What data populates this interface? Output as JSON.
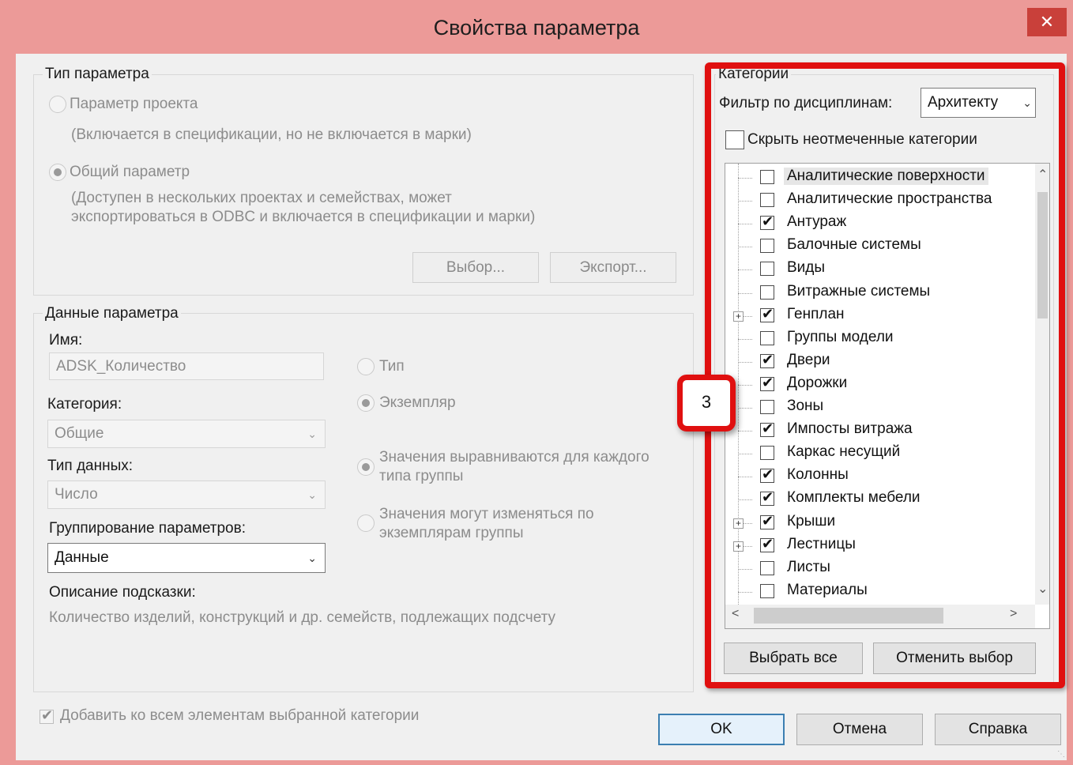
{
  "window": {
    "title": "Свойства параметра",
    "close_symbol": "✕"
  },
  "param_type": {
    "group_title": "Тип параметра",
    "project_param_label": "Параметр проекта",
    "project_param_note": "(Включается в спецификации, но не включается в марки)",
    "shared_param_label": "Общий параметр",
    "shared_param_note_1": "(Доступен в нескольких проектах и семействах, может",
    "shared_param_note_2": "экспортироваться в ODBC и включается в спецификации и марки)",
    "select_button": "Выбор...",
    "export_button": "Экспорт..."
  },
  "param_data": {
    "group_title": "Данные параметра",
    "name_label": "Имя:",
    "name_value": "ADSK_Количество",
    "category_label": "Категория:",
    "category_value": "Общие",
    "data_type_label": "Тип данных:",
    "data_type_value": "Число",
    "grouping_label": "Группирование параметров:",
    "grouping_value": "Данные",
    "tooltip_label": "Описание подсказки:",
    "tooltip_text": "Количество изделий, конструкций и др. семейств, подлежащих подсчету",
    "type_radio": "Тип",
    "instance_radio": "Экземпляр",
    "aligned_radio_1": "Значения выравниваются для каждого",
    "aligned_radio_2": "типа группы",
    "vary_radio_1": "Значения могут изменяться по",
    "vary_radio_2": "экземплярам группы"
  },
  "add_all_label": "Добавить ко всем элементам выбранной категории",
  "categories": {
    "group_title": "Категории",
    "filter_label": "Фильтр по дисциплинам:",
    "filter_value": "Архитекту",
    "hide_unchecked_label": "Скрыть неотмеченные категории",
    "items": [
      {
        "label": "Аналитические поверхности",
        "checked": false,
        "expandable": false
      },
      {
        "label": "Аналитические пространства",
        "checked": false,
        "expandable": false
      },
      {
        "label": "Антураж",
        "checked": true,
        "expandable": false
      },
      {
        "label": "Балочные системы",
        "checked": false,
        "expandable": false
      },
      {
        "label": "Виды",
        "checked": false,
        "expandable": false
      },
      {
        "label": "Витражные системы",
        "checked": false,
        "expandable": false
      },
      {
        "label": "Генплан",
        "checked": true,
        "expandable": true
      },
      {
        "label": "Группы модели",
        "checked": false,
        "expandable": false
      },
      {
        "label": "Двери",
        "checked": true,
        "expandable": false
      },
      {
        "label": "Дорожки",
        "checked": true,
        "expandable": false
      },
      {
        "label": "Зоны",
        "checked": false,
        "expandable": false
      },
      {
        "label": "Импосты витража",
        "checked": true,
        "expandable": false
      },
      {
        "label": "Каркас несущий",
        "checked": false,
        "expandable": false
      },
      {
        "label": "Колонны",
        "checked": true,
        "expandable": false
      },
      {
        "label": "Комплекты мебели",
        "checked": true,
        "expandable": false
      },
      {
        "label": "Крыши",
        "checked": true,
        "expandable": true
      },
      {
        "label": "Лестницы",
        "checked": true,
        "expandable": true
      },
      {
        "label": "Листы",
        "checked": false,
        "expandable": false
      },
      {
        "label": "Материалы",
        "checked": false,
        "expandable": false
      }
    ],
    "select_all_button": "Выбрать все",
    "deselect_button": "Отменить выбор"
  },
  "callout_number": "3",
  "buttons": {
    "ok": "OK",
    "cancel": "Отмена",
    "help": "Справка"
  },
  "colors": {
    "title_bar": "#ec9a98",
    "close_button": "#c9403a",
    "annotation_red": "#e01010"
  }
}
